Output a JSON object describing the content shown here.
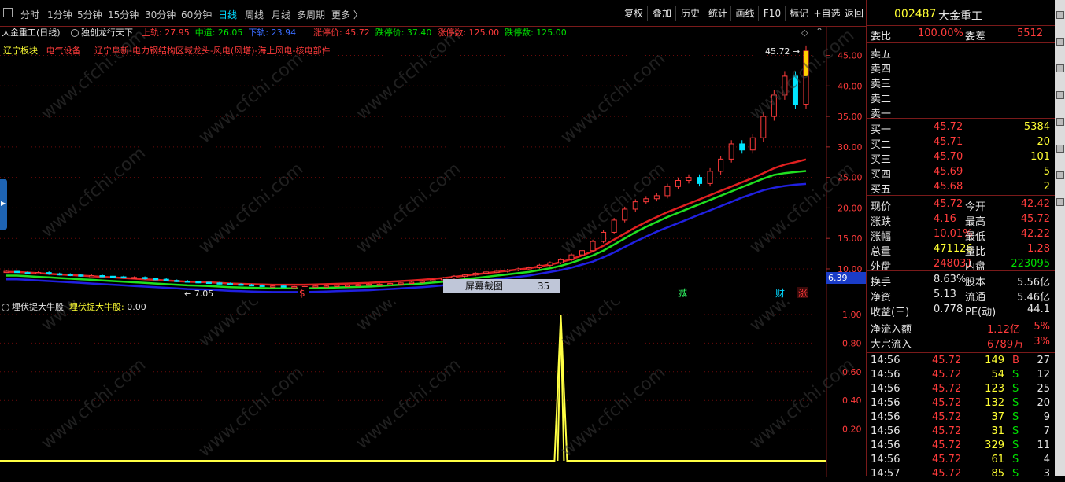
{
  "colors": {
    "up": "#ff3b3b",
    "down": "#00e5ff",
    "ma_red": "#e02020",
    "ma_green": "#20e020",
    "ma_blue": "#2020e0",
    "ind": "#ffff44",
    "grid": "#6a0a0a"
  },
  "toolbar": {
    "periods": [
      "分时",
      "1分钟",
      "5分钟",
      "15分钟",
      "30分钟",
      "60分钟",
      "日线",
      "周线",
      "月线",
      "多周期",
      "更多 〉"
    ],
    "active": "日线",
    "buttons": [
      "复权",
      "叠加",
      "历史",
      "统计",
      "画线",
      "F10",
      "标记",
      "+自选",
      "返回"
    ]
  },
  "chart": {
    "stock": "大金重工(日线)",
    "formula": "独创龙行天下",
    "up_label": "上轨: ",
    "up_val": "27.95",
    "mid_label": "中道: ",
    "mid_val": "26.05",
    "low_label": "下轨: ",
    "low_val": "23.94",
    "limit_up": "涨停价: 45.72",
    "limit_down": "跌停价: 37.40",
    "limit_up_count": "涨停数: 125.00",
    "limit_down_count": "跌停数: 125.00",
    "sector1": "辽宁板块",
    "sector2": "电气设备",
    "sector3": "辽宁阜新-电力钢结构区域龙头-风电(风塔)-海上风电-核电部件",
    "hi_label": "45.72",
    "lo_label": "← 7.05",
    "current_label": "6.39",
    "price_ticks": [
      "45.00",
      "40.00",
      "35.00",
      "30.00",
      "25.00",
      "20.00",
      "15.00",
      "10.00"
    ],
    "markers": [
      "$",
      "减",
      "财",
      "涨"
    ],
    "tooltip_label": "屏幕截图",
    "tooltip_val": "35",
    "watermark": "www.cfchi.com"
  },
  "chart_data": {
    "type": "line",
    "candles_close": [
      9.6,
      9.4,
      9.3,
      9.4,
      9.2,
      9.1,
      9.0,
      8.9,
      8.9,
      8.8,
      8.7,
      8.6,
      8.6,
      8.4,
      8.3,
      8.1,
      8.0,
      7.9,
      7.8,
      7.7,
      7.6,
      7.5,
      7.4,
      7.3,
      7.2,
      7.2,
      7.1,
      7.1,
      7.1,
      7.2,
      7.2,
      7.3,
      7.3,
      7.4,
      7.5,
      7.5,
      7.6,
      7.7,
      7.8,
      8.0,
      8.2,
      8.5,
      8.8,
      9.0,
      9.3,
      9.5,
      9.6,
      9.8,
      10.0,
      10.2,
      10.6,
      11.0,
      11.5,
      12.3,
      13.0,
      14.5,
      16.0,
      18.0,
      19.8,
      21.0,
      21.5,
      22.0,
      23.5,
      24.5,
      25.0,
      24.0,
      26.0,
      28.0,
      30.5,
      29.5,
      31.5,
      35.0,
      38.5,
      41.6,
      37.0,
      45.72
    ],
    "series": [
      {
        "name": "上轨",
        "values": [
          9.5,
          9.5,
          9.4,
          9.3,
          9.2,
          9.1,
          9.0,
          8.9,
          8.8,
          8.7,
          8.6,
          8.5,
          8.4,
          8.3,
          8.2,
          8.1,
          8.0,
          7.9,
          7.85,
          7.8,
          7.7,
          7.6,
          7.55,
          7.5,
          7.45,
          7.4,
          7.4,
          7.4,
          7.4,
          7.45,
          7.5,
          7.55,
          7.6,
          7.65,
          7.7,
          7.8,
          7.9,
          8.0,
          8.1,
          8.2,
          8.35,
          8.5,
          8.7,
          8.9,
          9.1,
          9.3,
          9.5,
          9.7,
          9.9,
          10.1,
          10.4,
          10.7,
          11.1,
          11.6,
          12.2,
          12.9,
          13.8,
          14.8,
          15.8,
          16.8,
          17.7,
          18.5,
          19.3,
          20.0,
          20.7,
          21.4,
          22.1,
          22.8,
          23.5,
          24.2,
          24.9,
          25.7,
          26.5,
          27.1,
          27.5,
          27.95
        ]
      },
      {
        "name": "中道",
        "values": [
          8.9,
          8.9,
          8.8,
          8.7,
          8.6,
          8.5,
          8.4,
          8.3,
          8.2,
          8.1,
          8.0,
          7.9,
          7.8,
          7.7,
          7.6,
          7.5,
          7.4,
          7.3,
          7.25,
          7.2,
          7.1,
          7.0,
          6.95,
          6.9,
          6.85,
          6.8,
          6.8,
          6.8,
          6.8,
          6.85,
          6.9,
          6.95,
          7.0,
          7.05,
          7.1,
          7.2,
          7.3,
          7.4,
          7.5,
          7.6,
          7.75,
          7.9,
          8.1,
          8.3,
          8.5,
          8.7,
          8.9,
          9.1,
          9.3,
          9.5,
          9.8,
          10.1,
          10.5,
          11.0,
          11.6,
          12.2,
          13.0,
          14.0,
          15.0,
          16.0,
          16.9,
          17.7,
          18.5,
          19.2,
          19.9,
          20.6,
          21.3,
          22.0,
          22.7,
          23.4,
          24.1,
          24.8,
          25.4,
          25.7,
          25.9,
          26.05
        ]
      },
      {
        "name": "下轨",
        "values": [
          8.3,
          8.3,
          8.2,
          8.1,
          8.0,
          7.9,
          7.8,
          7.7,
          7.6,
          7.5,
          7.4,
          7.3,
          7.2,
          7.1,
          7.0,
          6.9,
          6.8,
          6.7,
          6.65,
          6.6,
          6.5,
          6.4,
          6.35,
          6.3,
          6.25,
          6.2,
          6.2,
          6.2,
          6.2,
          6.25,
          6.3,
          6.35,
          6.4,
          6.45,
          6.5,
          6.6,
          6.7,
          6.8,
          6.9,
          7.0,
          7.15,
          7.3,
          7.5,
          7.7,
          7.9,
          8.1,
          8.3,
          8.5,
          8.7,
          8.9,
          9.2,
          9.5,
          9.8,
          10.2,
          10.7,
          11.2,
          11.9,
          12.7,
          13.6,
          14.5,
          15.3,
          16.1,
          16.8,
          17.5,
          18.2,
          18.9,
          19.6,
          20.3,
          21.0,
          21.7,
          22.3,
          22.9,
          23.3,
          23.6,
          23.8,
          23.94
        ]
      }
    ],
    "ylim": [
      6.0,
      47.0
    ],
    "indicator": {
      "ticks": [
        "1.00",
        "0.80",
        "0.60",
        "0.40",
        "0.20"
      ],
      "ylim": [
        0,
        1.02
      ],
      "peak_index": 52,
      "peak_value": 1.0
    }
  },
  "indicator": {
    "name": "埋伏捉大牛股",
    "label": "埋伏捉大牛股: ",
    "value": "0.00"
  },
  "quote": {
    "code": "002487",
    "name": "大金重工",
    "weibi_label": "委比",
    "weibi": "100.00%",
    "weicha_label": "委差",
    "weicha": "5512",
    "sells": [
      "卖五",
      "卖四",
      "卖三",
      "卖二",
      "卖一"
    ],
    "buys": [
      {
        "label": "买一",
        "price": "45.72",
        "vol": "5384"
      },
      {
        "label": "买二",
        "price": "45.71",
        "vol": "20"
      },
      {
        "label": "买三",
        "price": "45.70",
        "vol": "101"
      },
      {
        "label": "买四",
        "price": "45.69",
        "vol": "5"
      },
      {
        "label": "买五",
        "price": "45.68",
        "vol": "2"
      }
    ],
    "stats": [
      {
        "l1": "现价",
        "v1": "45.72",
        "l2": "今开",
        "v2": "42.42",
        "c1": "#ff3b3b",
        "c2": "#ff3b3b"
      },
      {
        "l1": "涨跌",
        "v1": "4.16",
        "l2": "最高",
        "v2": "45.72",
        "c1": "#ff3b3b",
        "c2": "#ff3b3b"
      },
      {
        "l1": "涨幅",
        "v1": "10.01%",
        "l2": "最低",
        "v2": "42.22",
        "c1": "#ff3b3b",
        "c2": "#ff3b3b"
      },
      {
        "l1": "总量",
        "v1": "471126",
        "l2": "量比",
        "v2": "1.28",
        "c1": "#ffff33",
        "c2": "#ff3b3b"
      },
      {
        "l1": "外盘",
        "v1": "248031",
        "l2": "内盘",
        "v2": "223095",
        "c1": "#ff3b3b",
        "c2": "#00e000"
      }
    ],
    "stats2": [
      {
        "l1": "换手",
        "v1": "8.63%",
        "l2": "股本",
        "v2": "5.56亿"
      },
      {
        "l1": "净资",
        "v1": "5.13",
        "l2": "流通",
        "v2": "5.46亿"
      },
      {
        "l1": "收益(三)",
        "v1": "0.778",
        "l2": "PE(动)",
        "v2": "44.1"
      }
    ],
    "flows": [
      {
        "l": "净流入额",
        "v": "1.12亿",
        "p": "5%"
      },
      {
        "l": "大宗流入",
        "v": "6789万",
        "p": "3%"
      }
    ],
    "ticks": [
      {
        "t": "14:56",
        "p": "45.72",
        "v": "149",
        "d": "B",
        "n": "27"
      },
      {
        "t": "14:56",
        "p": "45.72",
        "v": "54",
        "d": "S",
        "n": "12"
      },
      {
        "t": "14:56",
        "p": "45.72",
        "v": "123",
        "d": "S",
        "n": "25"
      },
      {
        "t": "14:56",
        "p": "45.72",
        "v": "132",
        "d": "S",
        "n": "20"
      },
      {
        "t": "14:56",
        "p": "45.72",
        "v": "37",
        "d": "S",
        "n": "9"
      },
      {
        "t": "14:56",
        "p": "45.72",
        "v": "31",
        "d": "S",
        "n": "7"
      },
      {
        "t": "14:56",
        "p": "45.72",
        "v": "329",
        "d": "S",
        "n": "11"
      },
      {
        "t": "14:56",
        "p": "45.72",
        "v": "61",
        "d": "S",
        "n": "4"
      },
      {
        "t": "14:57",
        "p": "45.72",
        "v": "85",
        "d": "S",
        "n": "3"
      }
    ]
  }
}
